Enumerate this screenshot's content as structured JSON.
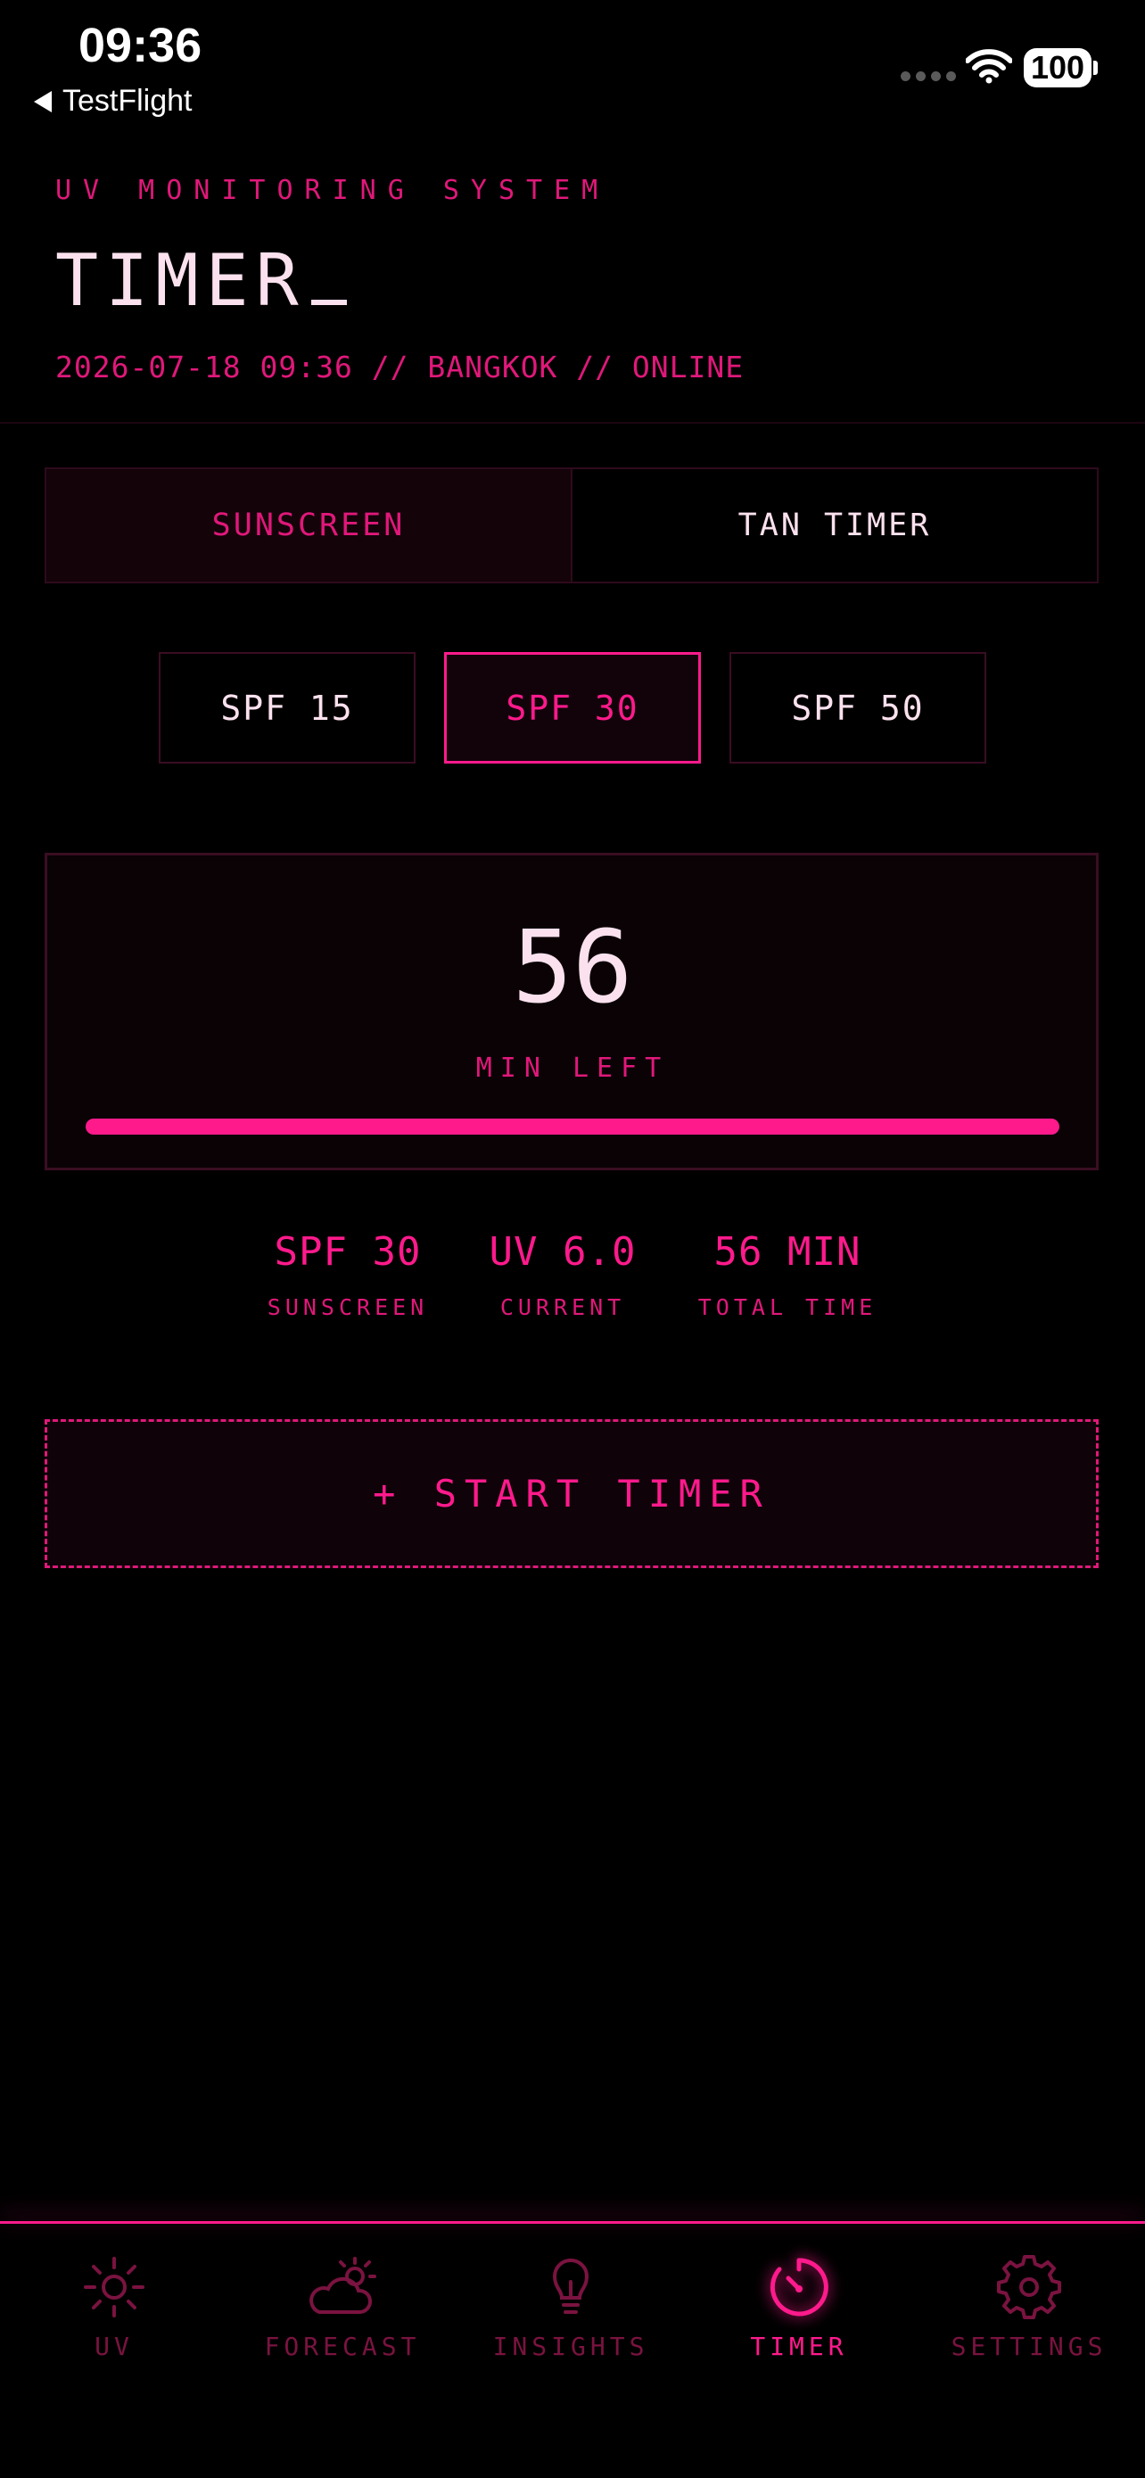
{
  "status_bar": {
    "time": "09:36",
    "back_label": "TestFlight",
    "battery": "100"
  },
  "header": {
    "subtitle": "UV MONITORING SYSTEM",
    "title": "TIMER",
    "meta": "2026-07-18 09:36 // BANGKOK // ONLINE"
  },
  "mode_tabs": [
    {
      "label": "SUNSCREEN",
      "active": true
    },
    {
      "label": "TAN TIMER",
      "active": false
    }
  ],
  "spf_options": [
    {
      "label": "SPF 15",
      "selected": false
    },
    {
      "label": "SPF 30",
      "selected": true
    },
    {
      "label": "SPF 50",
      "selected": false
    }
  ],
  "timer": {
    "minutes": "56",
    "unit_label": "MIN LEFT",
    "progress": 1.0
  },
  "stats": [
    {
      "value": "SPF 30",
      "label": "SUNSCREEN"
    },
    {
      "value": "UV 6.0",
      "label": "CURRENT"
    },
    {
      "value": "56 MIN",
      "label": "TOTAL TIME"
    }
  ],
  "start_button": "+ START TIMER",
  "nav": [
    {
      "label": "UV",
      "icon": "sun-icon",
      "active": false
    },
    {
      "label": "FORECAST",
      "icon": "cloud-sun-icon",
      "active": false
    },
    {
      "label": "INSIGHTS",
      "icon": "lightbulb-icon",
      "active": false
    },
    {
      "label": "TIMER",
      "icon": "timer-icon",
      "active": true
    },
    {
      "label": "SETTINGS",
      "icon": "gear-icon",
      "active": false
    }
  ],
  "colors": {
    "accent": "#ff1a8c",
    "accent_dim": "#7a1340",
    "text": "#fbe1ee",
    "background": "#000000"
  }
}
